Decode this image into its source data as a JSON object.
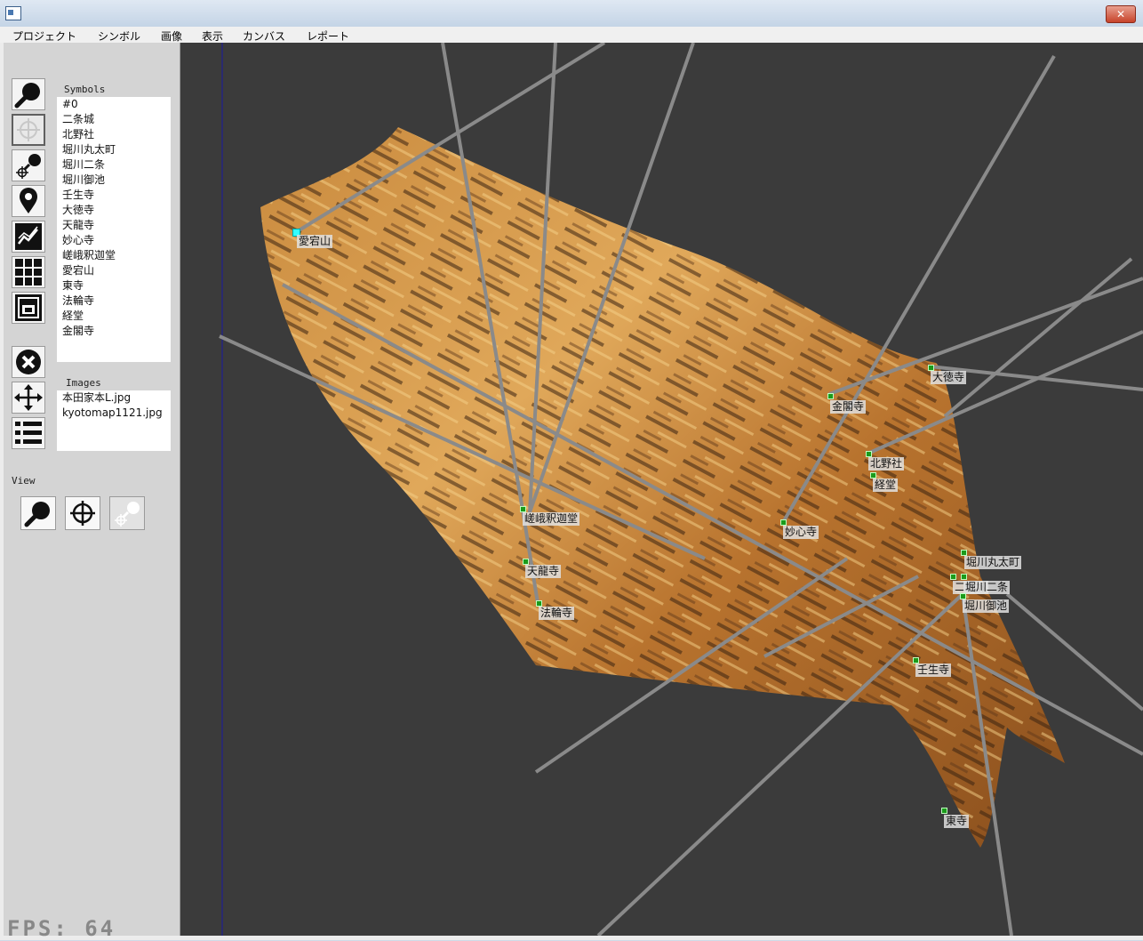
{
  "window": {
    "close_glyph": "✕"
  },
  "menu": [
    "プロジェクト",
    "シンボル",
    "画像",
    "表示",
    "カンバス",
    "レポート"
  ],
  "toolbar": [
    {
      "name": "zoom-icon",
      "selected": false
    },
    {
      "name": "crosshair-icon",
      "selected": true
    },
    {
      "name": "pin-crosshair-icon",
      "selected": false
    },
    {
      "name": "map-pin-icon",
      "selected": false
    },
    {
      "name": "chart-line-icon",
      "selected": false
    },
    {
      "name": "grid-icon",
      "selected": false
    },
    {
      "name": "frame-icon",
      "selected": false
    },
    {
      "name": "close-circle-icon",
      "selected": false
    },
    {
      "name": "move-icon",
      "selected": false
    },
    {
      "name": "list-icon",
      "selected": false
    }
  ],
  "symbols": {
    "label": "Symbols",
    "items": [
      "#0",
      "二条城",
      "北野社",
      "堀川丸太町",
      "堀川二条",
      "堀川御池",
      "壬生寺",
      "大徳寺",
      "天龍寺",
      "妙心寺",
      "嵯峨釈迦堂",
      "愛宕山",
      "東寺",
      "法輪寺",
      "経堂",
      "金閣寺"
    ]
  },
  "images": {
    "label": "Images",
    "items": [
      "本田家本L.jpg",
      "kyotomap1121.jpg"
    ]
  },
  "view": {
    "label": "View",
    "buttons": [
      "zoom-icon",
      "crosshair-icon",
      "pin-crosshair-icon"
    ]
  },
  "fps": "FPS: 64",
  "map_labels": [
    {
      "text": "愛宕山",
      "selected": true
    },
    {
      "text": "大徳寺"
    },
    {
      "text": "金閣寺"
    },
    {
      "text": "北野社"
    },
    {
      "text": "経堂"
    },
    {
      "text": "嵯峨釈迦堂"
    },
    {
      "text": "妙心寺"
    },
    {
      "text": "天龍寺"
    },
    {
      "text": "法輪寺"
    },
    {
      "text": "堀川丸太町"
    },
    {
      "text": "二条城"
    },
    {
      "text": "堀川二条"
    },
    {
      "text": "堀川御池"
    },
    {
      "text": "壬生寺"
    },
    {
      "text": "東寺"
    }
  ]
}
